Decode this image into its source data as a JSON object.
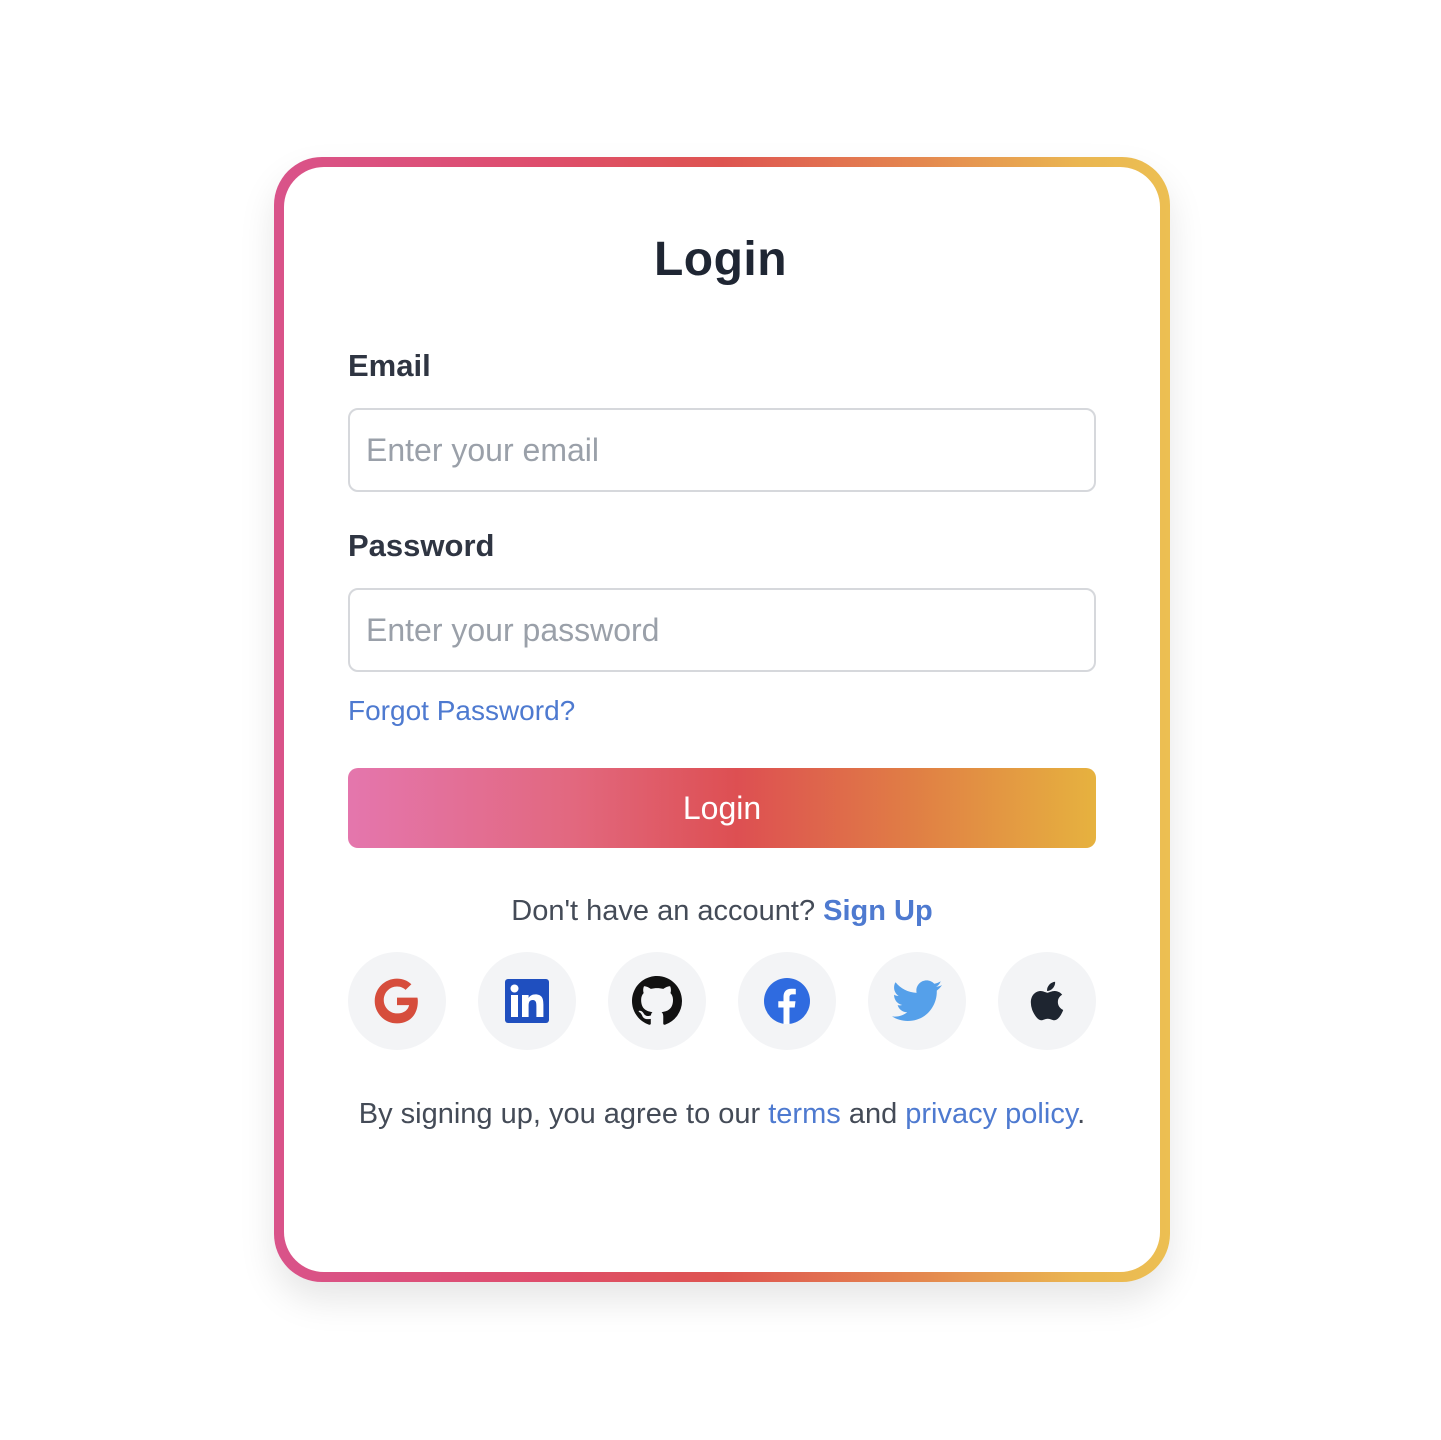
{
  "login_form": {
    "title": "Login",
    "email": {
      "label": "Email",
      "placeholder": "Enter your email",
      "value": ""
    },
    "password": {
      "label": "Password",
      "placeholder": "Enter your password",
      "value": ""
    },
    "forgot_password_label": "Forgot Password?",
    "submit_label": "Login",
    "signup_prompt": "Don't have an account?",
    "signup_link_label": "Sign Up",
    "social_providers": [
      {
        "name": "Google",
        "icon": "google-icon",
        "color": "#d64d3c"
      },
      {
        "name": "LinkedIn",
        "icon": "linkedin-icon",
        "color": "#1f4fbf"
      },
      {
        "name": "GitHub",
        "icon": "github-icon",
        "color": "#111111"
      },
      {
        "name": "Facebook",
        "icon": "facebook-icon",
        "color": "#2f6be0"
      },
      {
        "name": "Twitter",
        "icon": "twitter-icon",
        "color": "#55a0ea"
      },
      {
        "name": "Apple",
        "icon": "apple-icon",
        "color": "#1e2530"
      }
    ],
    "terms": {
      "prefix": "By signing up, you agree to our",
      "terms_link": "terms",
      "conjunction": "and",
      "privacy_link": "privacy policy",
      "suffix": "."
    }
  },
  "colors": {
    "accent_link": "#4e7ad0",
    "gradient_start": "#d9538a",
    "gradient_mid": "#dd4f52",
    "gradient_end": "#ecbf52",
    "title_text": "#1f2633",
    "social_bg": "#f3f4f6"
  }
}
